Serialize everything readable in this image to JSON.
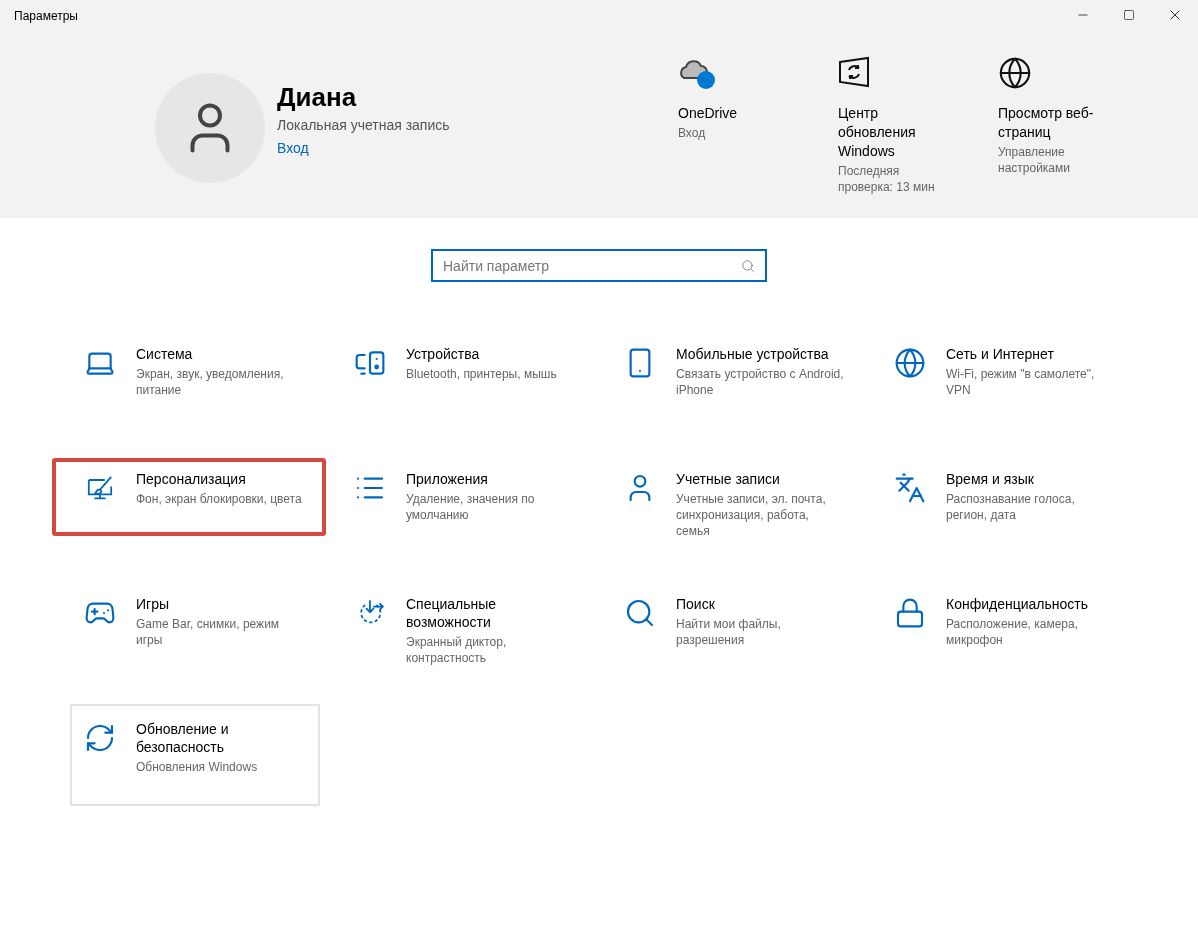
{
  "window": {
    "title": "Параметры"
  },
  "account": {
    "name": "Диана",
    "type": "Локальная учетная запись",
    "link": "Вход"
  },
  "quick_links": [
    {
      "title": "OneDrive",
      "subtitle": "Вход"
    },
    {
      "title": "Центр обновления Windows",
      "subtitle": "Последняя проверка: 13 мин"
    },
    {
      "title": "Просмотр веб-страниц",
      "subtitle": "Управление настройками"
    }
  ],
  "search": {
    "placeholder": "Найти параметр"
  },
  "categories": [
    {
      "title": "Система",
      "description": "Экран, звук, уведомления, питание",
      "highlighted": false,
      "focused": false
    },
    {
      "title": "Устройства",
      "description": "Bluetooth, принтеры, мышь",
      "highlighted": false,
      "focused": false
    },
    {
      "title": "Мобильные устройства",
      "description": "Связать устройство с Android, iPhone",
      "highlighted": false,
      "focused": false
    },
    {
      "title": "Сеть и Интернет",
      "description": "Wi-Fi, режим \"в самолете\", VPN",
      "highlighted": false,
      "focused": false
    },
    {
      "title": "Персонализация",
      "description": "Фон, экран блокировки, цвета",
      "highlighted": true,
      "focused": false
    },
    {
      "title": "Приложения",
      "description": "Удаление, значения по умолчанию",
      "highlighted": false,
      "focused": false
    },
    {
      "title": "Учетные записи",
      "description": "Учетные записи, эл. почта, синхронизация, работа, семья",
      "highlighted": false,
      "focused": false
    },
    {
      "title": "Время и язык",
      "description": "Распознавание голоса, регион, дата",
      "highlighted": false,
      "focused": false
    },
    {
      "title": "Игры",
      "description": "Game Bar, снимки, режим игры",
      "highlighted": false,
      "focused": false
    },
    {
      "title": "Специальные возможности",
      "description": "Экранный диктор, контрастность",
      "highlighted": false,
      "focused": false
    },
    {
      "title": "Поиск",
      "description": "Найти мои файлы, разрешения",
      "highlighted": false,
      "focused": false
    },
    {
      "title": "Конфиденциальность",
      "description": "Расположение, камера, микрофон",
      "highlighted": false,
      "focused": false
    },
    {
      "title": "Обновление и безопасность",
      "description": "Обновления Windows",
      "highlighted": false,
      "focused": true
    }
  ]
}
